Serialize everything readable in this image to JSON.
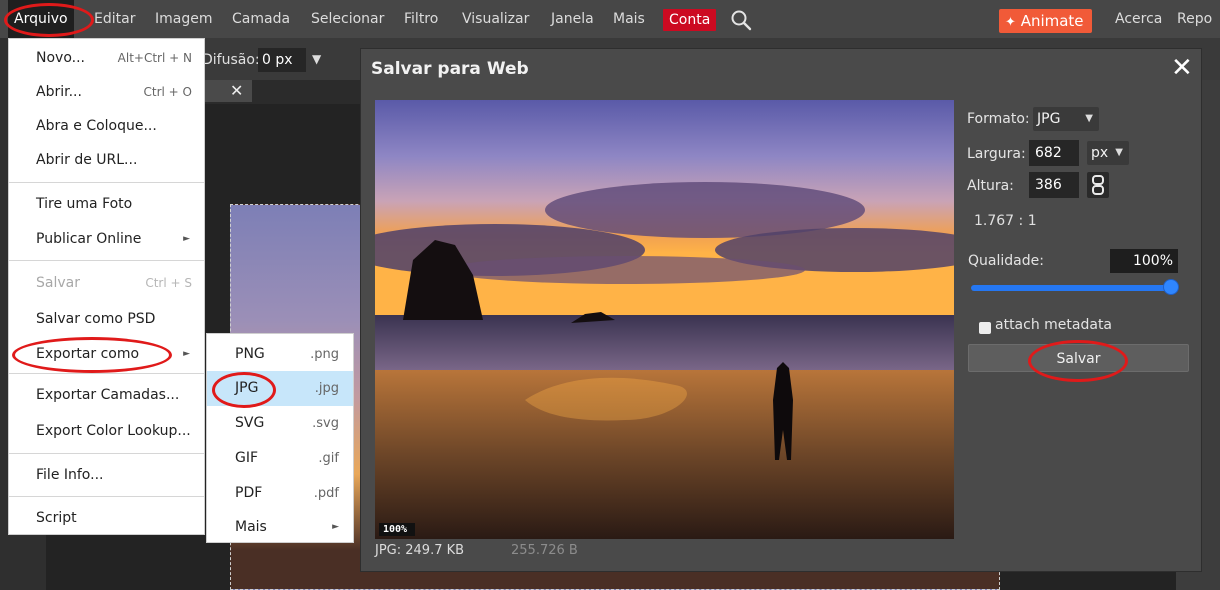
{
  "menubar": {
    "items": [
      "Arquivo",
      "Editar",
      "Imagem",
      "Camada",
      "Selecionar",
      "Filtro",
      "Visualizar",
      "Janela",
      "Mais"
    ],
    "account": "Conta",
    "animate": "Animate",
    "about": "Acerca",
    "report": "Repo"
  },
  "toolbar": {
    "diffusion_label": "Difusão:",
    "diffusion_value": "0 px"
  },
  "file_menu": {
    "items": [
      {
        "label": "Novo...",
        "shortcut": "Alt+Ctrl + N"
      },
      {
        "label": "Abrir...",
        "shortcut": "Ctrl + O"
      },
      {
        "label": "Abra e Coloque..."
      },
      {
        "label": "Abrir de URL..."
      },
      {
        "label": "Tire uma Foto"
      },
      {
        "label": "Publicar Online"
      },
      {
        "label": "Salvar",
        "shortcut": "Ctrl + S"
      },
      {
        "label": "Salvar como PSD"
      },
      {
        "label": "Exportar como"
      },
      {
        "label": "Exportar Camadas..."
      },
      {
        "label": "Export Color Lookup..."
      },
      {
        "label": "File Info..."
      },
      {
        "label": "Script"
      }
    ]
  },
  "export_submenu": {
    "items": [
      {
        "label": "PNG",
        "ext": ".png"
      },
      {
        "label": "JPG",
        "ext": ".jpg"
      },
      {
        "label": "SVG",
        "ext": ".svg"
      },
      {
        "label": "GIF",
        "ext": ".gif"
      },
      {
        "label": "PDF",
        "ext": ".pdf"
      },
      {
        "label": "Mais"
      }
    ]
  },
  "dialog": {
    "title": "Salvar para Web",
    "zoom": "100%",
    "file_size": "JPG:  249.7 KB",
    "bytes": "255.726 B",
    "format_label": "Formato:",
    "format_value": "JPG",
    "width_label": "Largura:",
    "width_value": "682",
    "unit": "px",
    "height_label": "Altura:",
    "height_value": "386",
    "ratio": "1.767 : 1",
    "quality_label": "Qualidade:",
    "quality_value": "100%",
    "quality_level": 1.0,
    "metadata_label": "attach metadata",
    "save_label": "Salvar"
  },
  "colors": {
    "accent_red": "#cc0a21",
    "animate_orange": "#f15a38",
    "highlight_blue": "#c7e6fa",
    "slider_blue": "#2577f2",
    "annotation_red": "#e01a1a"
  }
}
